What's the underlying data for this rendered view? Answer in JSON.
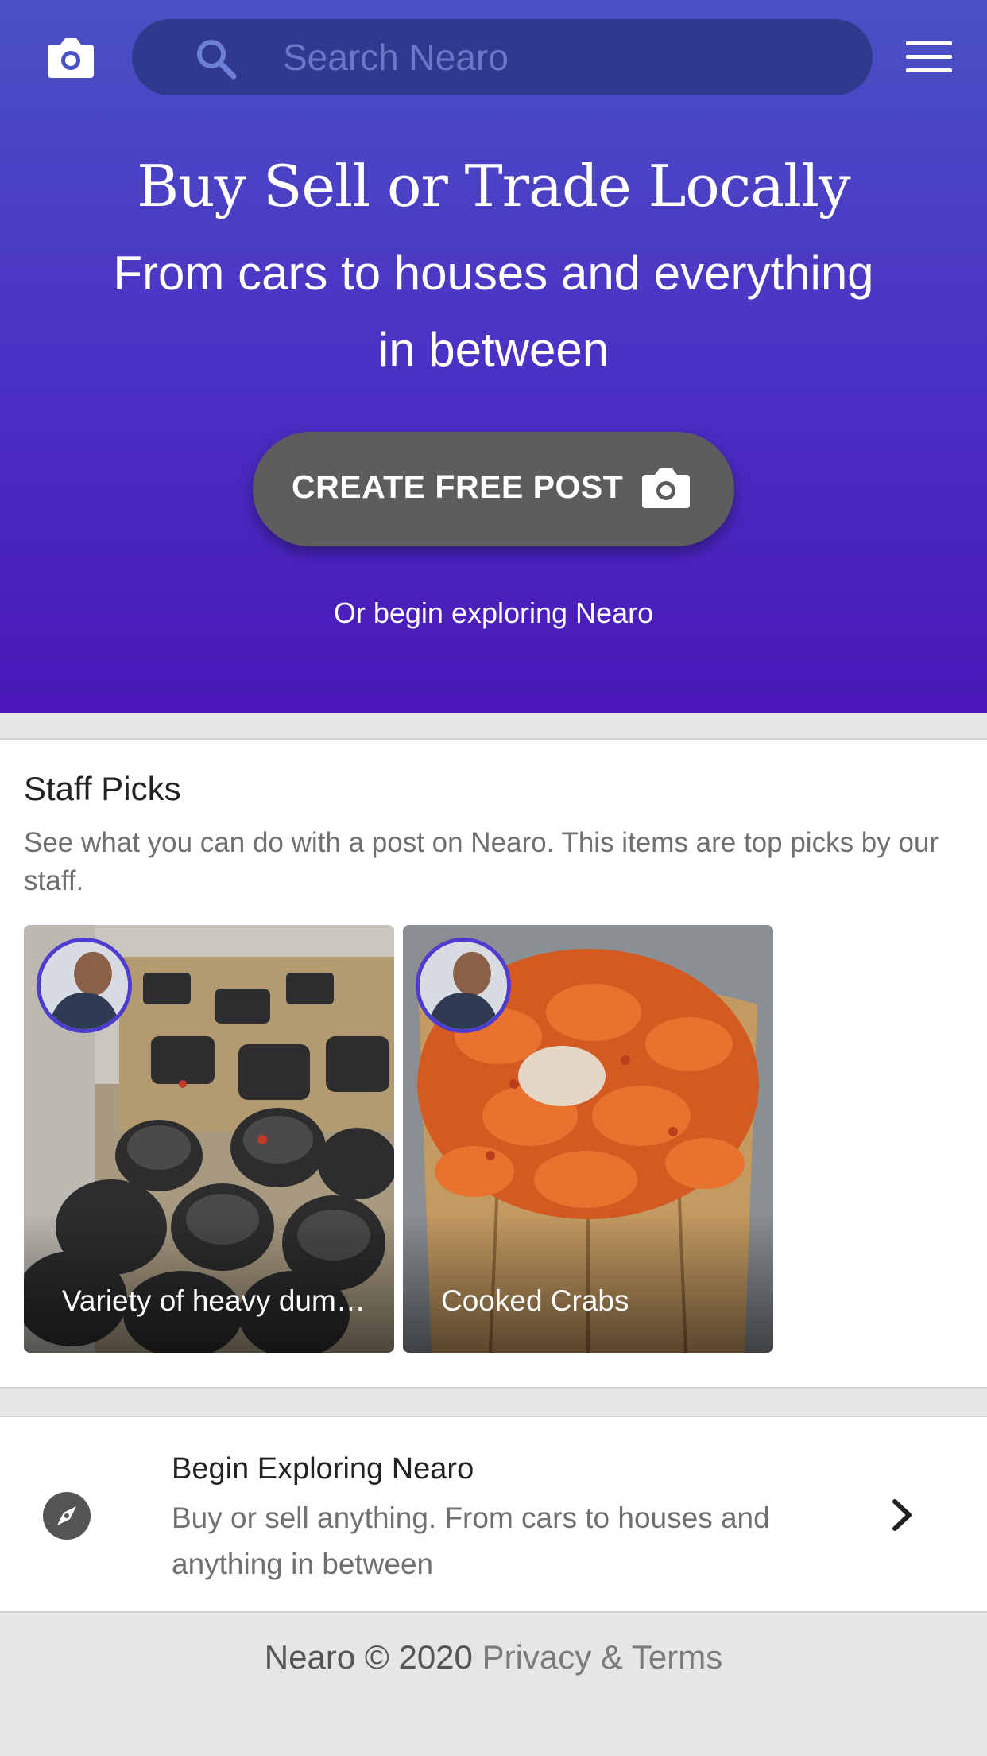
{
  "header": {
    "search_placeholder": "Search Nearo",
    "camera_icon": "camera-icon",
    "search_icon": "search-icon",
    "menu_icon": "hamburger-menu-icon"
  },
  "hero": {
    "title": "Buy Sell or Trade Locally",
    "subtitle": "From cars to houses and everything in between",
    "cta_label": "CREATE FREE POST",
    "cta_icon": "camera-icon",
    "explore_link": "Or begin exploring Nearo"
  },
  "staff_picks": {
    "title": "Staff Picks",
    "description": "See what you can do with a post on Nearo. This items are top picks by our staff.",
    "items": [
      {
        "label": "Variety of heavy dumbbells"
      },
      {
        "label": "Cooked Crabs"
      }
    ]
  },
  "explore": {
    "title": "Begin Exploring Nearo",
    "description": "Buy or sell anything. From cars to houses and anything in between",
    "icon": "compass-icon",
    "chevron_icon": "chevron-right-icon"
  },
  "footer": {
    "copyright": "Nearo © 2020",
    "link": "Privacy & Terms"
  },
  "colors": {
    "hero_top": "#4a51c5",
    "hero_bottom": "#4a18b8",
    "search_bg": "#2f3a8f",
    "cta_bg": "#5d5d5f",
    "page_bg": "#e6e6e6"
  }
}
